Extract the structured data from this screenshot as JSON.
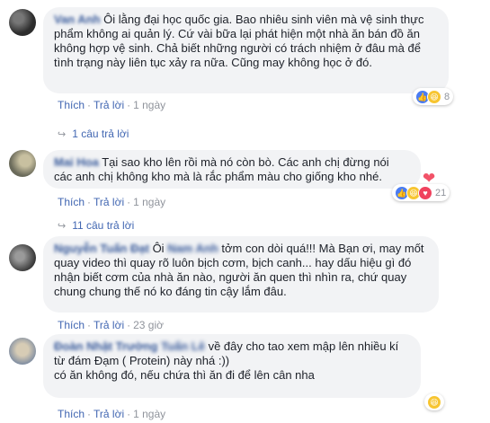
{
  "comments": [
    {
      "name": "Van Anh",
      "text": "Ôi lằng đại học quốc gia. Bao nhiêu sinh viên mà vệ sinh thực phẩm không ai quản lý. Cứ vài bữa lại phát hiện một nhà ăn bán đồ ăn không hợp vệ sinh. Chả biết những người có trách nhiệm ở đâu mà để tình trạng này liên tục xảy ra nữa. Cũng may không học ở đó.",
      "reaction_count": "8",
      "like": "Thích",
      "reply": "Trả lời",
      "time": "1 ngày",
      "replies": "1 câu trả lời"
    },
    {
      "name": "Mai Hoa",
      "text": "Tại sao kho lên rồi mà nó còn bò. Các anh chị đừng nói các anh chị không kho mà là rắc phẩm màu cho giống kho nhé.",
      "heart": "❤",
      "reaction_count": "21",
      "like": "Thích",
      "reply": "Trả lời",
      "time": "1 ngày",
      "replies": "11 câu trả lời"
    },
    {
      "name": "Nguyễn Tuấn Đạt",
      "text_before": "Ôi",
      "mention": "Nam Anh",
      "text_after": "tởm con dòi quá!!! Mà Bạn ơi, may mốt quay video thì quay rõ luôn bịch cơm, bịch canh... hay dấu hiệu gì đó nhận biết cơm của nhà ăn nào, người ăn quen thì nhìn ra, chứ quay chung chung thế nó ko đáng tin cậy lắm đâu.",
      "like": "Thích",
      "reply": "Trả lời",
      "time": "23 giờ"
    },
    {
      "name": "Đoàn Nhật Trường",
      "mention": "Tuấn Lê",
      "text_after": "về đây cho tao xem mập lên nhiều kí từ đám Đạm ( Protein) này nhá :))",
      "text_line2": "có ăn không đó, nếu chứa thì ăn đi để lên cân nha",
      "like": "Thích",
      "reply": "Trả lời",
      "time": "1 ngày"
    }
  ],
  "colors": {
    "link": "#4267b2",
    "name": "#365899",
    "meta": "#90949c",
    "bubble": "#f2f3f5"
  }
}
